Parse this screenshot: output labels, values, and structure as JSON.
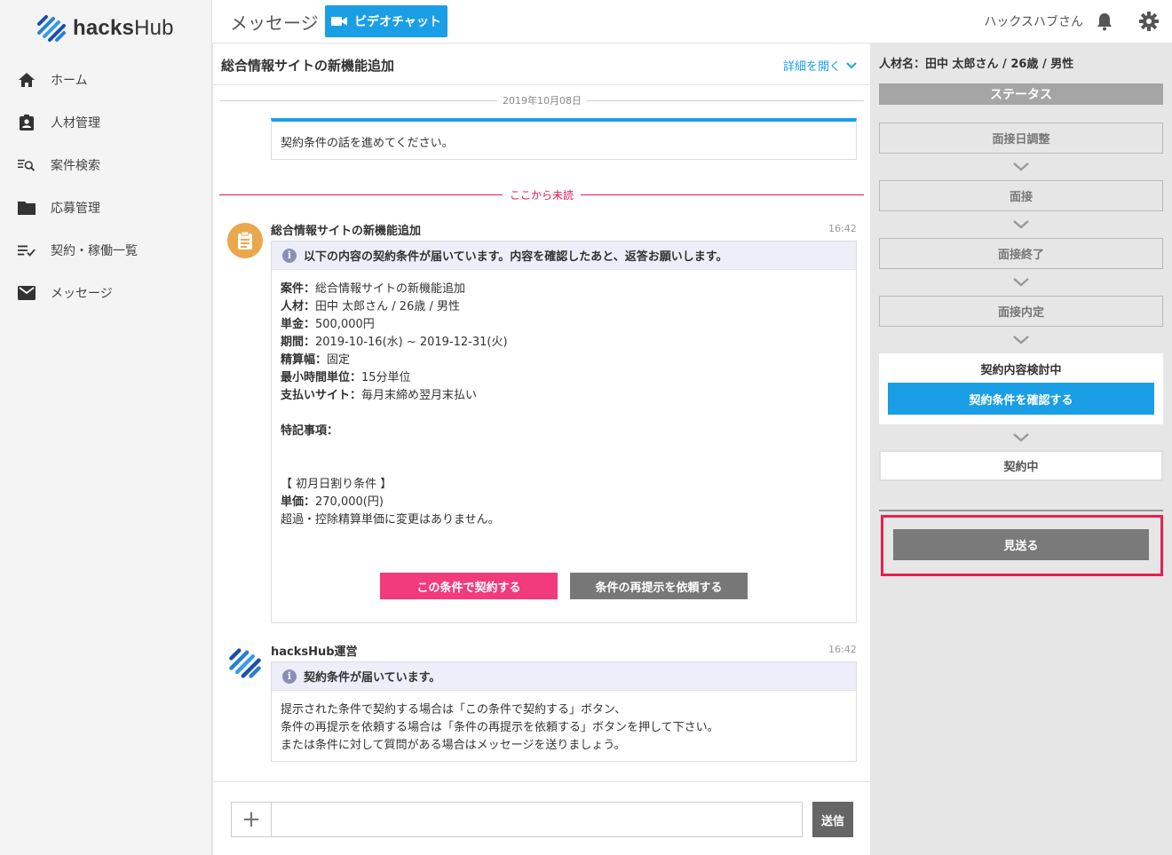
{
  "app": {
    "logo_bold": "hacks",
    "logo_light": "Hub"
  },
  "sidebar": {
    "items": [
      {
        "label": "ホーム",
        "icon": "home-icon"
      },
      {
        "label": "人材管理",
        "icon": "id-badge-icon"
      },
      {
        "label": "案件検索",
        "icon": "list-search-icon"
      },
      {
        "label": "応募管理",
        "icon": "folder-icon"
      },
      {
        "label": "契約・稼働一覧",
        "icon": "list-check-icon"
      },
      {
        "label": "メッセージ",
        "icon": "mail-icon"
      }
    ]
  },
  "header": {
    "title": "メッセージ",
    "video_button": "ビデオチャット",
    "user_name": "ハックスハブさん"
  },
  "chat": {
    "title": "総合情報サイトの新機能追加",
    "detail_link": "詳細を開く",
    "date_separator": "2019年10月08日",
    "note": "契約条件の話を進めてください。",
    "unread_separator": "ここから未読",
    "messages": [
      {
        "sender": "総合情報サイトの新機能追加",
        "time": "16:42",
        "banner": "以下の内容の契約条件が届いています。内容を確認したあと、返答お願いします。",
        "fields": [
          {
            "label": "案件：",
            "value": "総合情報サイトの新機能追加"
          },
          {
            "label": "人材：",
            "value": "田中 太郎さん / 26歳 / 男性"
          },
          {
            "label": "単金：",
            "value": "500,000円"
          },
          {
            "label": "期間：",
            "value": "2019-10-16(水) ~ 2019-12-31(火)"
          },
          {
            "label": "精算幅：",
            "value": "固定"
          },
          {
            "label": "最小時間単位：",
            "value": "15分単位"
          },
          {
            "label": "支払いサイト：",
            "value": "毎月末締め翌月末払い"
          }
        ],
        "notes_label": "特記事項：",
        "proration_title": "【 初月日割り条件 】",
        "unit_price_label": "単価：",
        "unit_price_value": "270,000(円)",
        "proration_note": "超過・控除精算単価に変更はありません。",
        "agree_button": "この条件で契約する",
        "retry_button": "条件の再提示を依頼する"
      },
      {
        "sender": "hacksHub運営",
        "time": "16:42",
        "banner": "契約条件が届いています。",
        "lines": [
          "提示された条件で契約する場合は「この条件で契約する」ボタン、",
          "条件の再提示を依頼する場合は「条件の再提示を依頼する」ボタンを押して下さい。",
          "または条件に対して質問がある場合はメッセージを送りましょう。"
        ]
      }
    ],
    "input": {
      "placeholder": "",
      "send_label": "送信",
      "plus_label": "+"
    }
  },
  "status_panel": {
    "person": "人材名：田中 太郎さん / 26歳 / 男性",
    "heading": "ステータス",
    "steps": [
      "面接日調整",
      "面接",
      "面接終了",
      "面接内定"
    ],
    "current_step": "契約内容検討中",
    "confirm_button": "契約条件を確認する",
    "next_step": "契約中",
    "pass_button": "見送る"
  },
  "colors": {
    "accent": "#1a9ee6",
    "danger": "#e5184d",
    "agree": "#f23b7c",
    "highlight": "#e8204f"
  }
}
